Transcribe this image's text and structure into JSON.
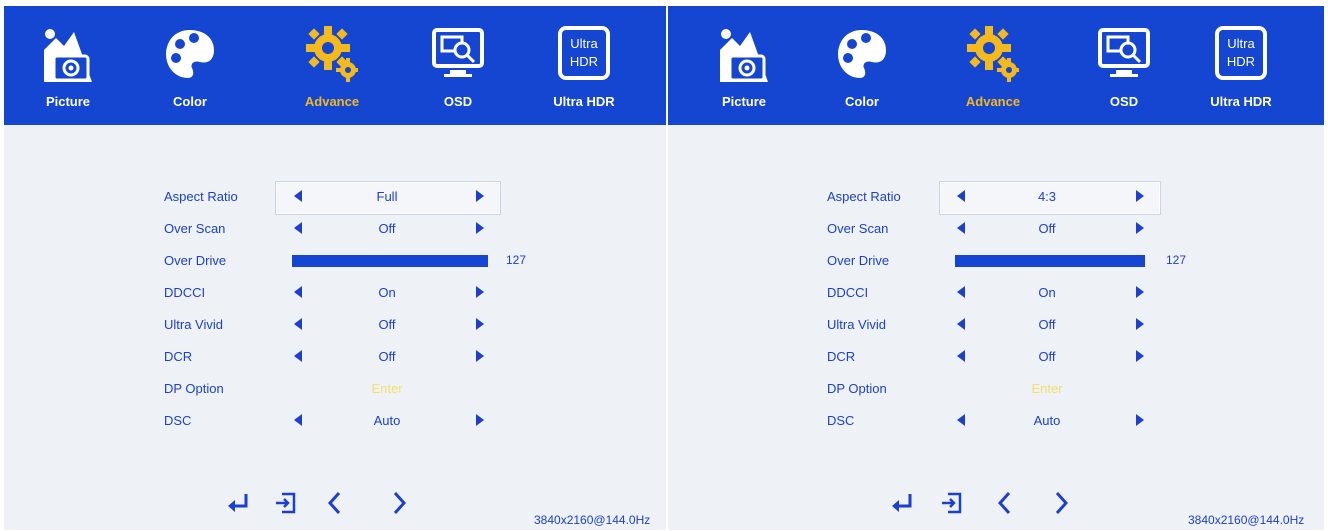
{
  "tabs": [
    {
      "label": "Picture",
      "icon": "picture-icon"
    },
    {
      "label": "Color",
      "icon": "color-palette-icon"
    },
    {
      "label": "Advance",
      "icon": "gear-icon"
    },
    {
      "label": "OSD",
      "icon": "osd-icon"
    },
    {
      "label": "Ultra HDR",
      "icon": "ultra-hdr-icon"
    }
  ],
  "ultra_hdr_icon_text": {
    "line1": "Ultra",
    "line2": "HDR"
  },
  "active_tab": "Advance",
  "colors": {
    "accent_blue": "#1446d2",
    "active_tab_text": "#f3b91d",
    "menu_text": "#1c3fd0",
    "enter_text": "#f6d94a",
    "panel_bg": "#eef2f7"
  },
  "left": {
    "settings": {
      "aspect_ratio": {
        "label": "Aspect Ratio",
        "value": "Full"
      },
      "over_scan": {
        "label": "Over Scan",
        "value": "Off"
      },
      "over_drive": {
        "label": "Over Drive",
        "value": "127",
        "level_fraction": 1.0
      },
      "ddcci": {
        "label": "DDCCI",
        "value": "On"
      },
      "ultra_vivid": {
        "label": "Ultra Vivid",
        "value": "Off"
      },
      "dcr": {
        "label": "DCR",
        "value": "Off"
      },
      "dp_option": {
        "label": "DP Option",
        "value": "Enter"
      },
      "dsc": {
        "label": "DSC",
        "value": "Auto"
      }
    },
    "resolution": "3840x2160@144.0Hz"
  },
  "right": {
    "settings": {
      "aspect_ratio": {
        "label": "Aspect Ratio",
        "value": "4:3"
      },
      "over_scan": {
        "label": "Over Scan",
        "value": "Off"
      },
      "over_drive": {
        "label": "Over Drive",
        "value": "127",
        "level_fraction": 1.0
      },
      "ddcci": {
        "label": "DDCCI",
        "value": "On"
      },
      "ultra_vivid": {
        "label": "Ultra Vivid",
        "value": "Off"
      },
      "dcr": {
        "label": "DCR",
        "value": "Off"
      },
      "dp_option": {
        "label": "DP Option",
        "value": "Enter"
      },
      "dsc": {
        "label": "DSC",
        "value": "Auto"
      }
    },
    "resolution": "3840x2160@144.0Hz"
  },
  "nav_icons": [
    "enter-icon",
    "exit-icon",
    "chevron-left-icon",
    "chevron-right-icon"
  ]
}
